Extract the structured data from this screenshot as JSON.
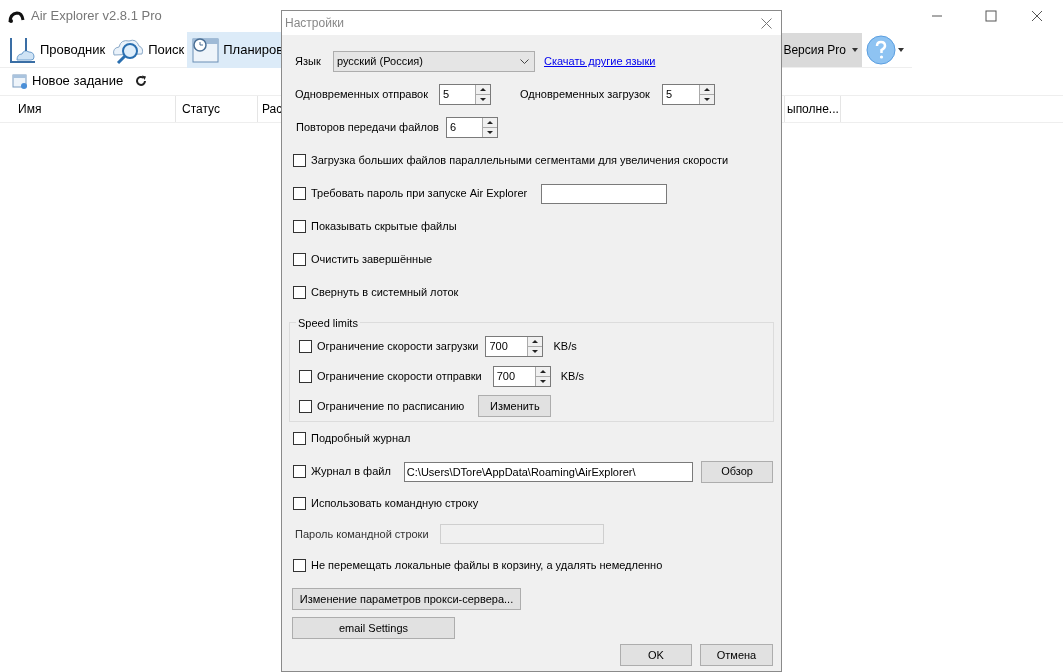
{
  "window": {
    "title": "Air Explorer v2.8.1 Pro"
  },
  "toolbar": {
    "items": [
      {
        "label": "Проводник",
        "selected": false,
        "kind": "explorer"
      },
      {
        "label": "Поиск",
        "selected": false,
        "kind": "search"
      },
      {
        "label": "Планиров",
        "selected": true,
        "kind": "scheduler"
      }
    ],
    "pro_menu": "Версия Pro"
  },
  "subtoolbar": {
    "new_task": "Новое задание"
  },
  "columns": [
    "Имя",
    "Статус",
    "Рас",
    "ыполне..."
  ],
  "dialog": {
    "title": "Настройки",
    "language": {
      "label": "Язык",
      "value": "русский (Россия)",
      "link": "Скачать другие языки"
    },
    "uploads": {
      "label": "Одновременных отправок",
      "value": "5"
    },
    "downloads": {
      "label": "Одновременных загрузок",
      "value": "5"
    },
    "retries": {
      "label": "Повторов передачи файлов",
      "value": "6"
    },
    "options": [
      {
        "label": "Загрузка больших файлов параллельными сегментами для увеличения скорости",
        "checked": false,
        "kind": "plain"
      },
      {
        "label": "Требовать пароль при запуске Air Explorer",
        "checked": false,
        "kind": "password"
      },
      {
        "label": "Показывать скрытые файлы",
        "checked": false,
        "kind": "plain"
      },
      {
        "label": "Очистить завершённые",
        "checked": false,
        "kind": "plain"
      },
      {
        "label": "Свернуть в системный лоток",
        "checked": false,
        "kind": "plain"
      }
    ],
    "speed": {
      "title": "Speed limits",
      "download": {
        "label": "Ограничение скорости загрузки",
        "checked": false,
        "value": "700",
        "unit": "KB/s"
      },
      "upload": {
        "label": "Ограничение скорости отправки",
        "checked": false,
        "value": "700",
        "unit": "KB/s"
      },
      "schedule": {
        "label": "Ограничение по расписанию",
        "checked": false,
        "button": "Изменить"
      }
    },
    "verbose_log": {
      "label": "Подробный журнал",
      "checked": false
    },
    "log_file": {
      "label": "Журнал в файл",
      "checked": false,
      "path": "C:\\Users\\DTore\\AppData\\Roaming\\AirExplorer\\",
      "button": "Обзор"
    },
    "command_line": {
      "label": "Использовать командную строку",
      "checked": false
    },
    "command_password": {
      "label": "Пароль командной строки",
      "disabled": true
    },
    "no_recycle": {
      "label": "Не перемещать локальные файлы в корзину, а удалять немедленно",
      "checked": false
    },
    "proxy_button": "Изменение параметров прокси-сервера...",
    "email_button": "email Settings",
    "ok": "OK",
    "cancel": "Отмена"
  }
}
